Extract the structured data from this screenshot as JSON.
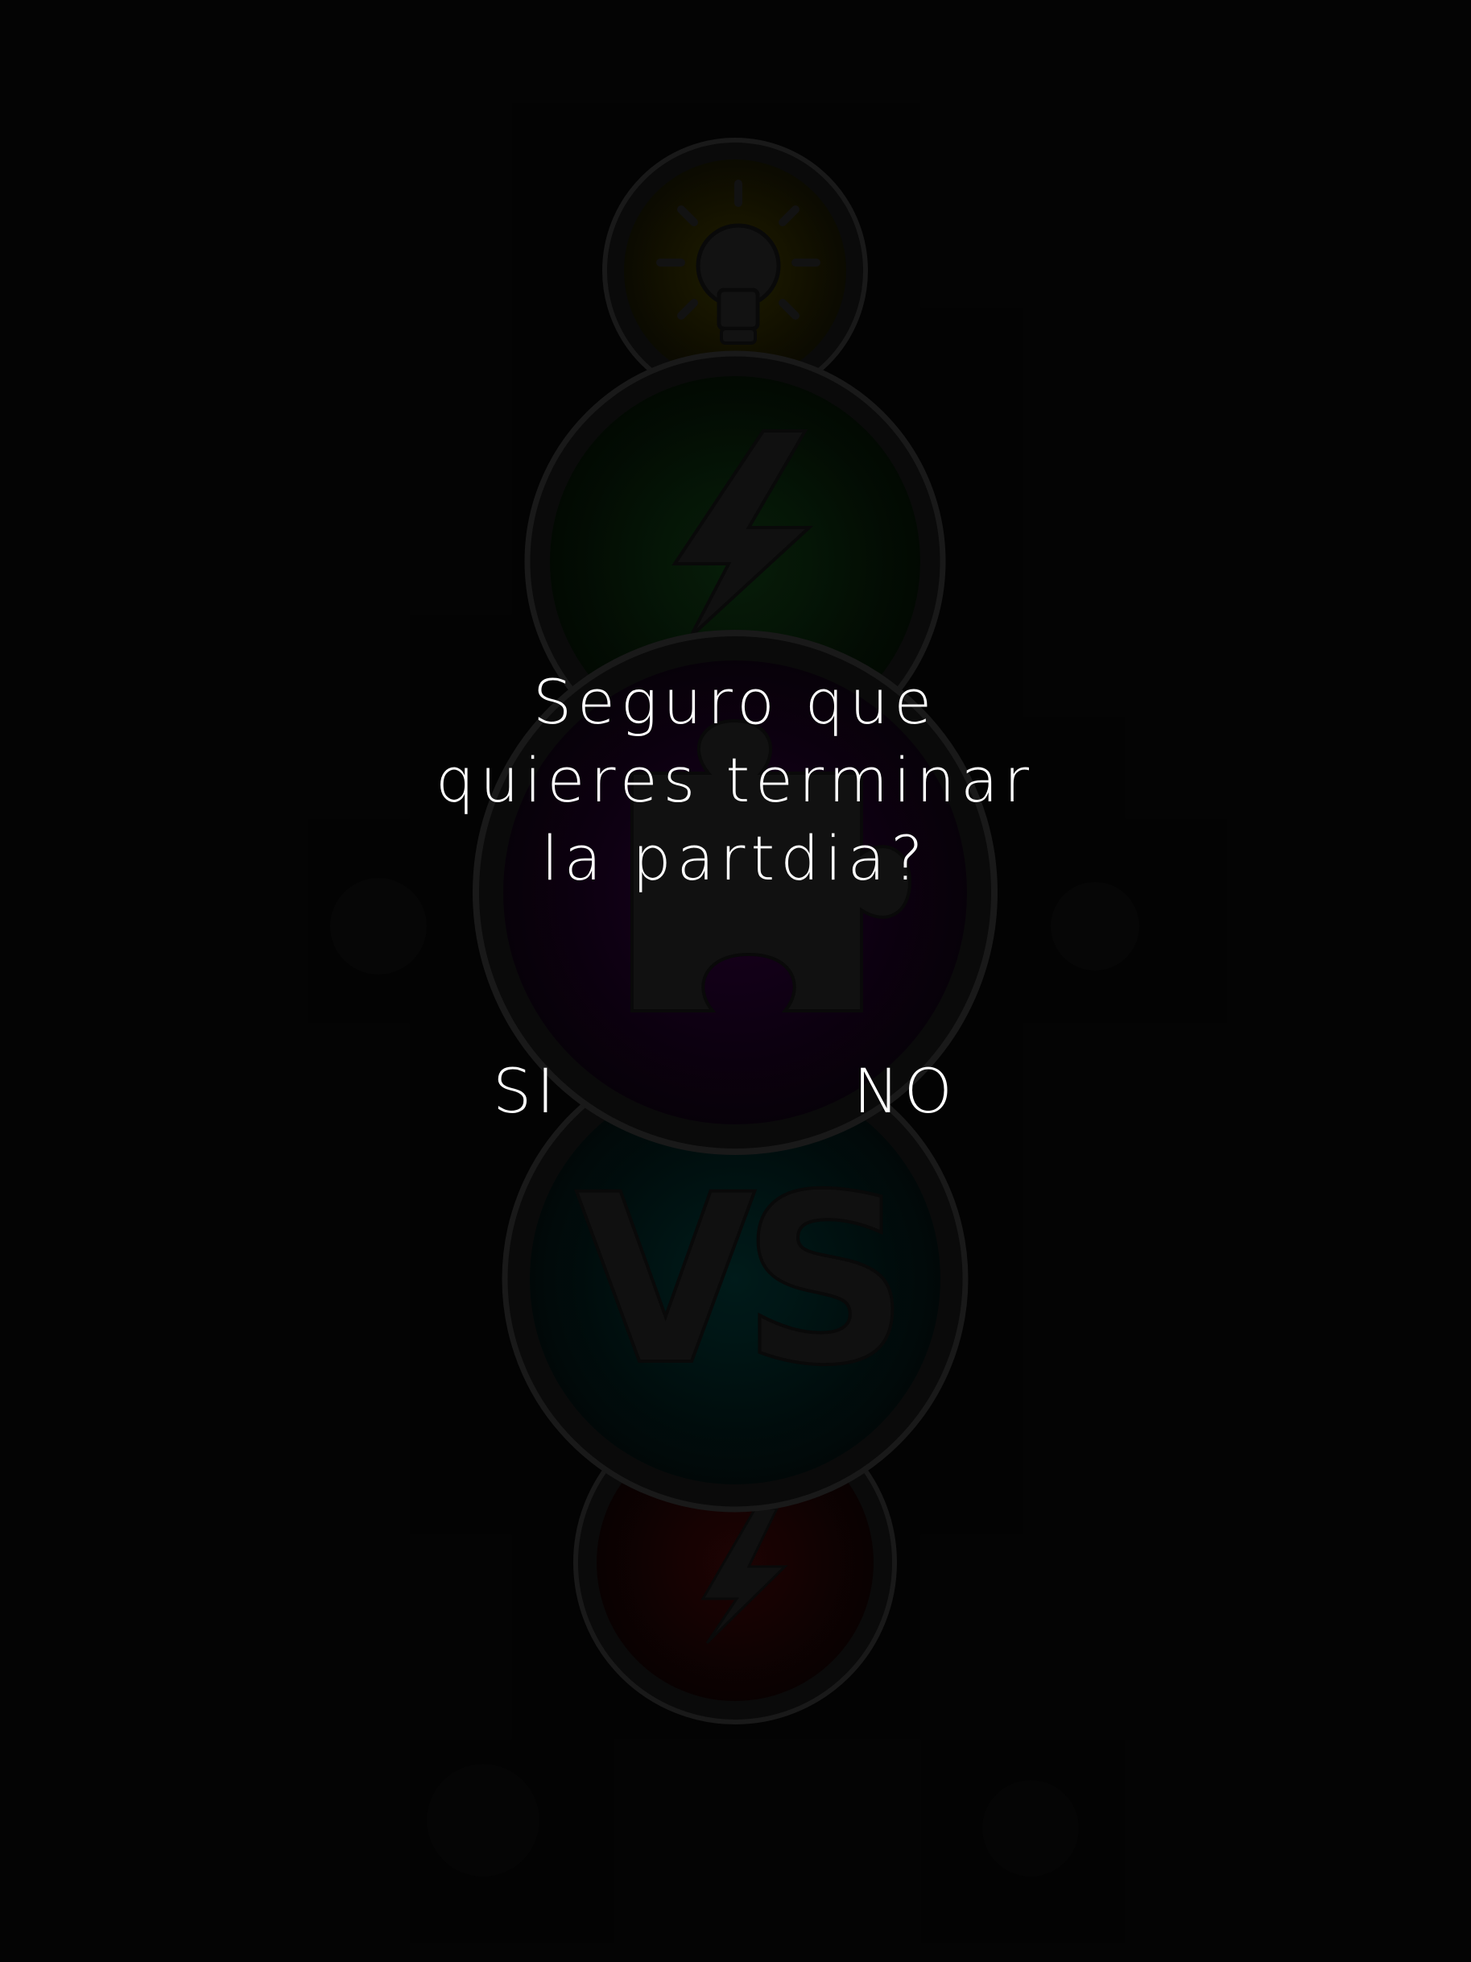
{
  "dialog": {
    "question": "Seguro que\nquieres terminar\nla partdia?",
    "yes_label": "SI",
    "no_label": "NO"
  },
  "background_menu": {
    "buttons": [
      {
        "icon": "lightbulb-icon",
        "color": "#1c1a00"
      },
      {
        "icon": "lightning-bolt-icon",
        "color": "#071a05"
      },
      {
        "icon": "puzzle-piece-icon",
        "color": "#14001a"
      },
      {
        "icon": "versus-icon",
        "label": "VS",
        "color": "#001716"
      },
      {
        "icon": "lightning-bolt-icon",
        "color": "#1a0303"
      }
    ]
  },
  "colors": {
    "background": "#040404",
    "text": "#ffffff",
    "button_ring": "#1c1c1c"
  }
}
